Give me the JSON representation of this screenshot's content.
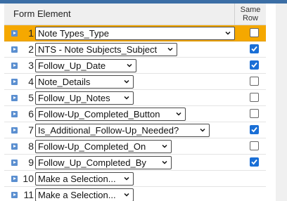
{
  "header": {
    "form_element_label": "Form Element",
    "same_row_line1": "Same",
    "same_row_line2": "Row"
  },
  "rows": [
    {
      "number": "1",
      "value": "Note Types_Type",
      "same_row": false,
      "selected": true
    },
    {
      "number": "2",
      "value": "NTS - Note Subjects_Subject",
      "same_row": true,
      "selected": false
    },
    {
      "number": "3",
      "value": "Follow_Up_Date",
      "same_row": true,
      "selected": false
    },
    {
      "number": "4",
      "value": "Note_Details",
      "same_row": false,
      "selected": false
    },
    {
      "number": "5",
      "value": "Follow_Up_Notes",
      "same_row": false,
      "selected": false
    },
    {
      "number": "6",
      "value": "Follow-Up_Completed_Button",
      "same_row": false,
      "selected": false
    },
    {
      "number": "7",
      "value": "Is_Additional_Follow-Up_Needed?",
      "same_row": true,
      "selected": false
    },
    {
      "number": "8",
      "value": "Follow-Up_Completed_On",
      "same_row": false,
      "selected": false
    },
    {
      "number": "9",
      "value": "Follow_Up_Completed_By",
      "same_row": true,
      "selected": false
    },
    {
      "number": "10",
      "value": "Make a Selection...",
      "same_row": null,
      "selected": false
    },
    {
      "number": "11",
      "value": "Make a Selection...",
      "same_row": null,
      "selected": false
    }
  ],
  "colors": {
    "accent": "#1a6fd6",
    "selected_row": "#f5a800",
    "expander": "#5b8fd0"
  },
  "icons": {
    "expander": "expand-arrow-icon",
    "dropdown": "chevron-down-icon",
    "check": "checkmark-icon"
  }
}
